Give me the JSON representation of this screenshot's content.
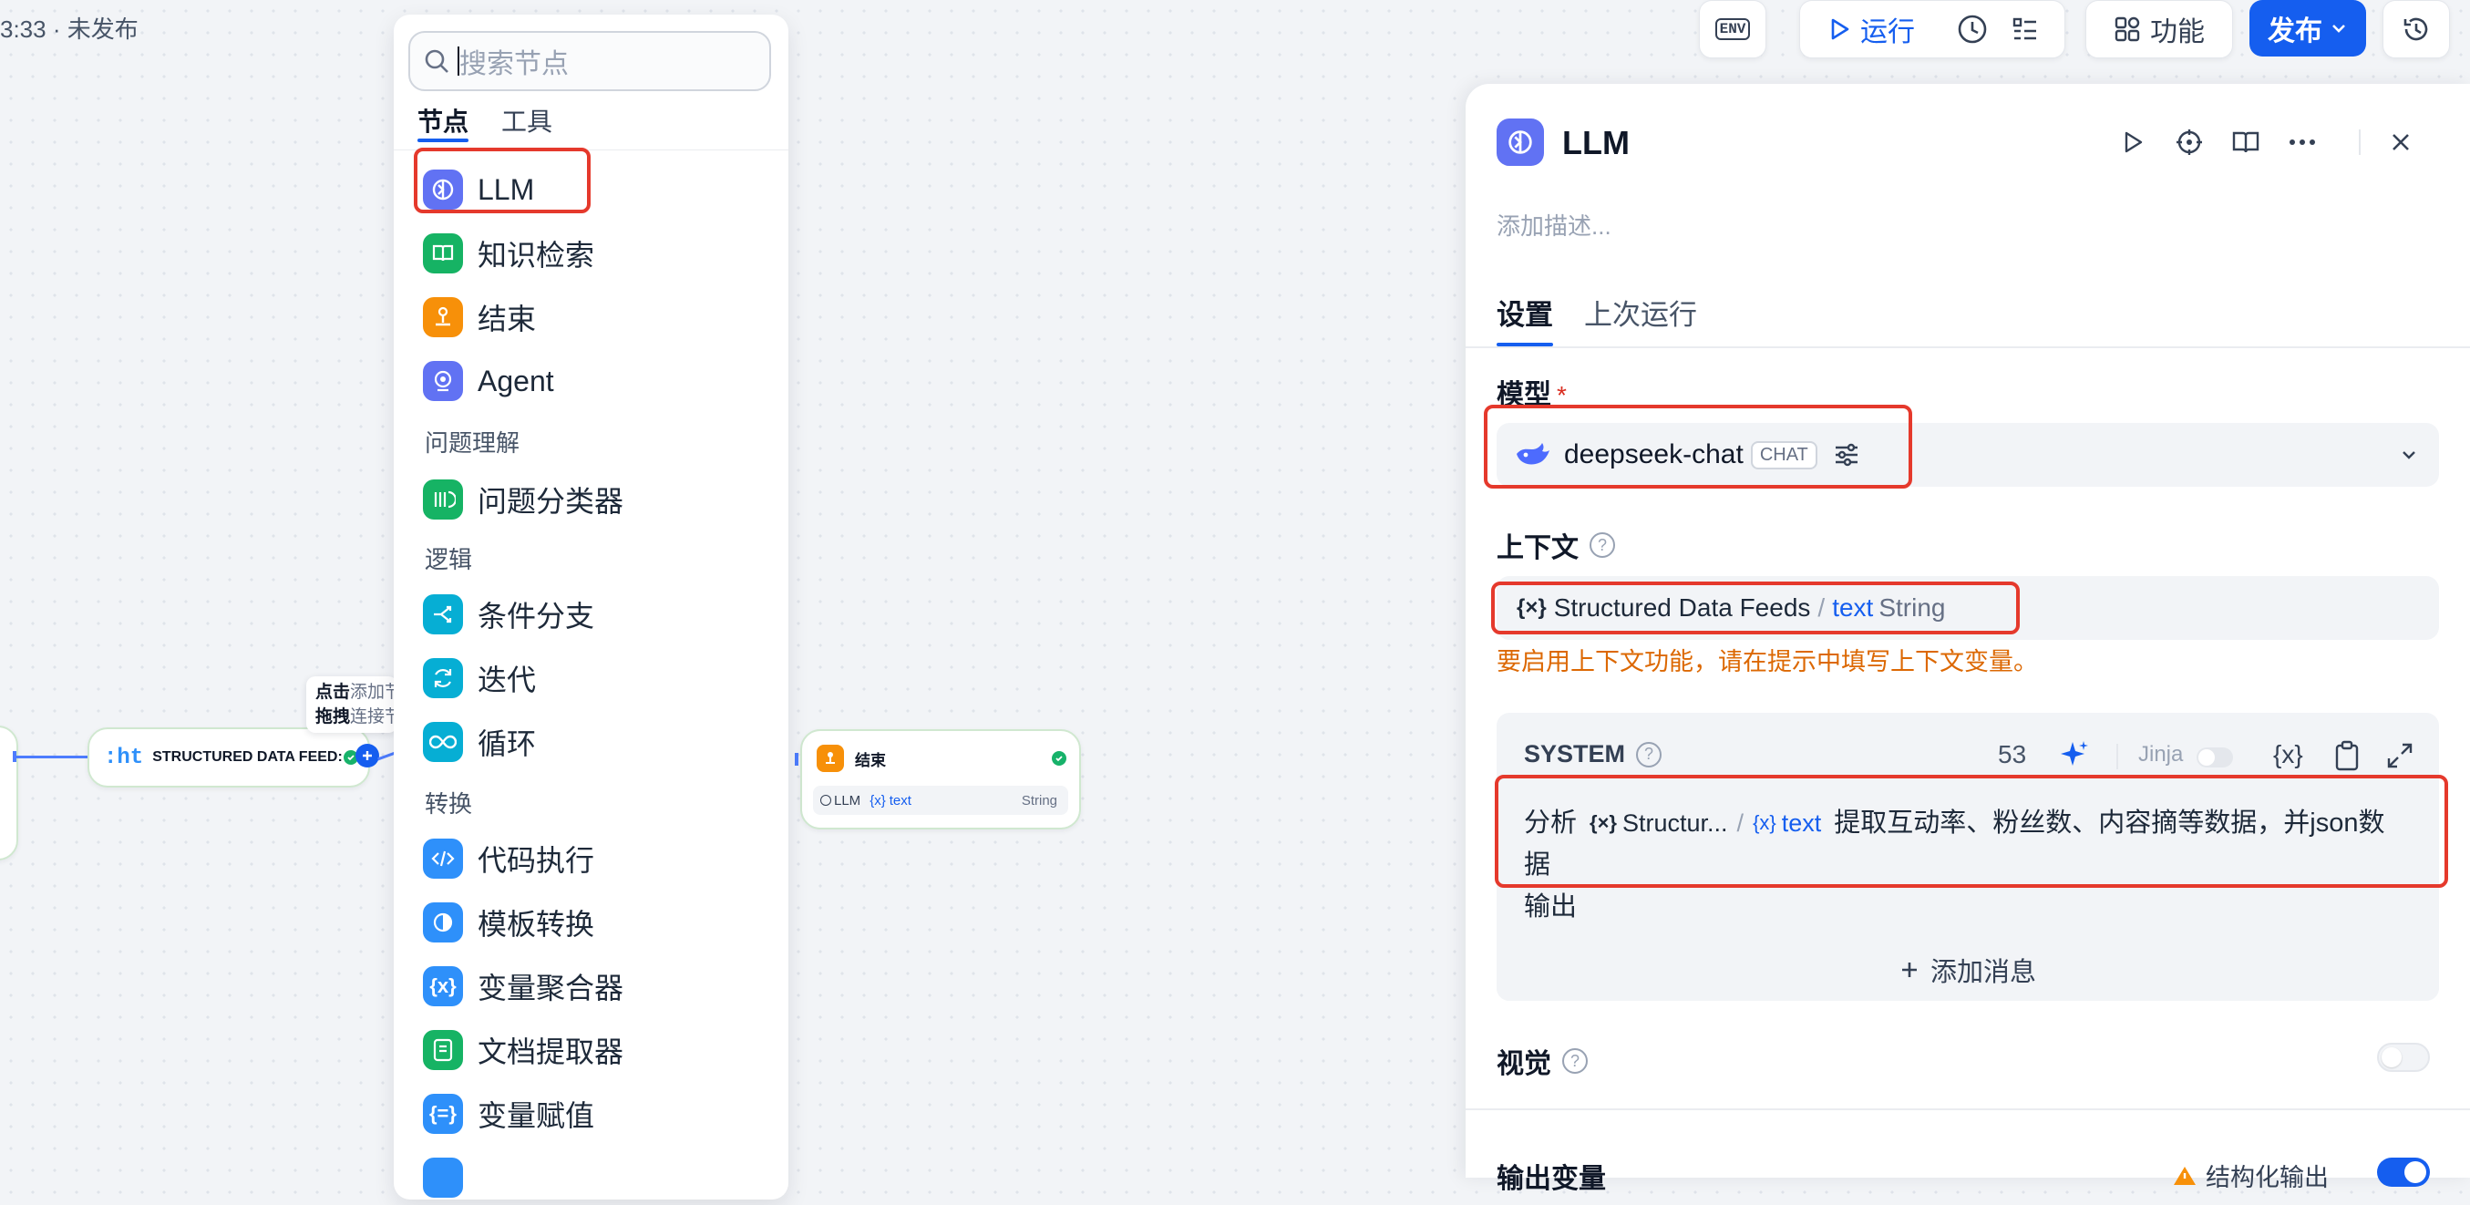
{
  "status": {
    "text": "3:33 · 未发布"
  },
  "toolbar": {
    "env_label": "ENV",
    "run_label": "运行",
    "feature_label": "功能",
    "publish_label": "发布"
  },
  "canvas": {
    "node_structured": {
      "icon_text": ":ht",
      "title": "STRUCTURED DATA FEED:"
    },
    "tooltip": {
      "line1_a": "点击",
      "line1_b": "添加节",
      "line2_a": "拖拽",
      "line2_b": "连接节"
    },
    "end_node": {
      "title": "结束",
      "var_source": "LLM",
      "var_name": "text",
      "var_type": "String"
    }
  },
  "node_panel": {
    "search_placeholder": "搜索节点",
    "tabs": [
      "节点",
      "工具"
    ],
    "items_top": [
      {
        "label": "LLM",
        "icon": "llm-icon",
        "color": "#6172f3"
      },
      {
        "label": "知识检索",
        "icon": "book-icon",
        "color": "#16b364"
      },
      {
        "label": "结束",
        "icon": "end-icon",
        "color": "#f79009"
      },
      {
        "label": "Agent",
        "icon": "agent-icon",
        "color": "#6172f3"
      }
    ],
    "group_understanding": "问题理解",
    "items_understanding": [
      {
        "label": "问题分类器",
        "icon": "classifier-icon",
        "color": "#16b364"
      }
    ],
    "group_logic": "逻辑",
    "items_logic": [
      {
        "label": "条件分支",
        "icon": "branch-icon",
        "color": "#06aed4"
      },
      {
        "label": "迭代",
        "icon": "iteration-icon",
        "color": "#06aed4"
      },
      {
        "label": "循环",
        "icon": "loop-icon",
        "color": "#06aed4"
      }
    ],
    "group_transform": "转换",
    "items_transform": [
      {
        "label": "代码执行",
        "icon": "code-icon",
        "color": "#2e90fa"
      },
      {
        "label": "模板转换",
        "icon": "template-icon",
        "color": "#2e90fa"
      },
      {
        "label": "变量聚合器",
        "icon": "variable-icon",
        "color": "#2e90fa"
      },
      {
        "label": "文档提取器",
        "icon": "doc-extract-icon",
        "color": "#16b364"
      },
      {
        "label": "变量赋值",
        "icon": "assign-icon",
        "color": "#2e90fa"
      }
    ]
  },
  "right_panel": {
    "title": "LLM",
    "description_placeholder": "添加描述...",
    "tabs": [
      "设置",
      "上次运行"
    ],
    "model": {
      "label": "模型",
      "required_mark": "*",
      "name": "deepseek-chat",
      "badge": "CHAT"
    },
    "context": {
      "label": "上下文",
      "var_node": "Structured Data Feeds",
      "var_sep": "/",
      "var_name": "text",
      "var_type": "String",
      "warning": "要启用上下文功能，请在提示中填写上下文变量。"
    },
    "system": {
      "label": "SYSTEM",
      "token_count": "53",
      "jinja_label": "Jinja",
      "var_insert_label": "{x}",
      "prompt_prefix": "分析",
      "prompt_var_node": "Structur...",
      "prompt_var_sep": "/",
      "prompt_var_name": "text",
      "prompt_suffix": "提取互动率、粉丝数、内容摘等数据，并json数",
      "prompt_line2": "据",
      "prompt_line3": "输出"
    },
    "add_message_label": "添加消息",
    "vision": {
      "label": "视觉",
      "enabled": false
    },
    "output": {
      "label": "输出变量",
      "structured_label": "结构化输出",
      "structured_enabled": true
    }
  },
  "colors": {
    "accent": "#155eef",
    "annotation_red": "#e5392c",
    "warning_orange": "#dc6803"
  }
}
